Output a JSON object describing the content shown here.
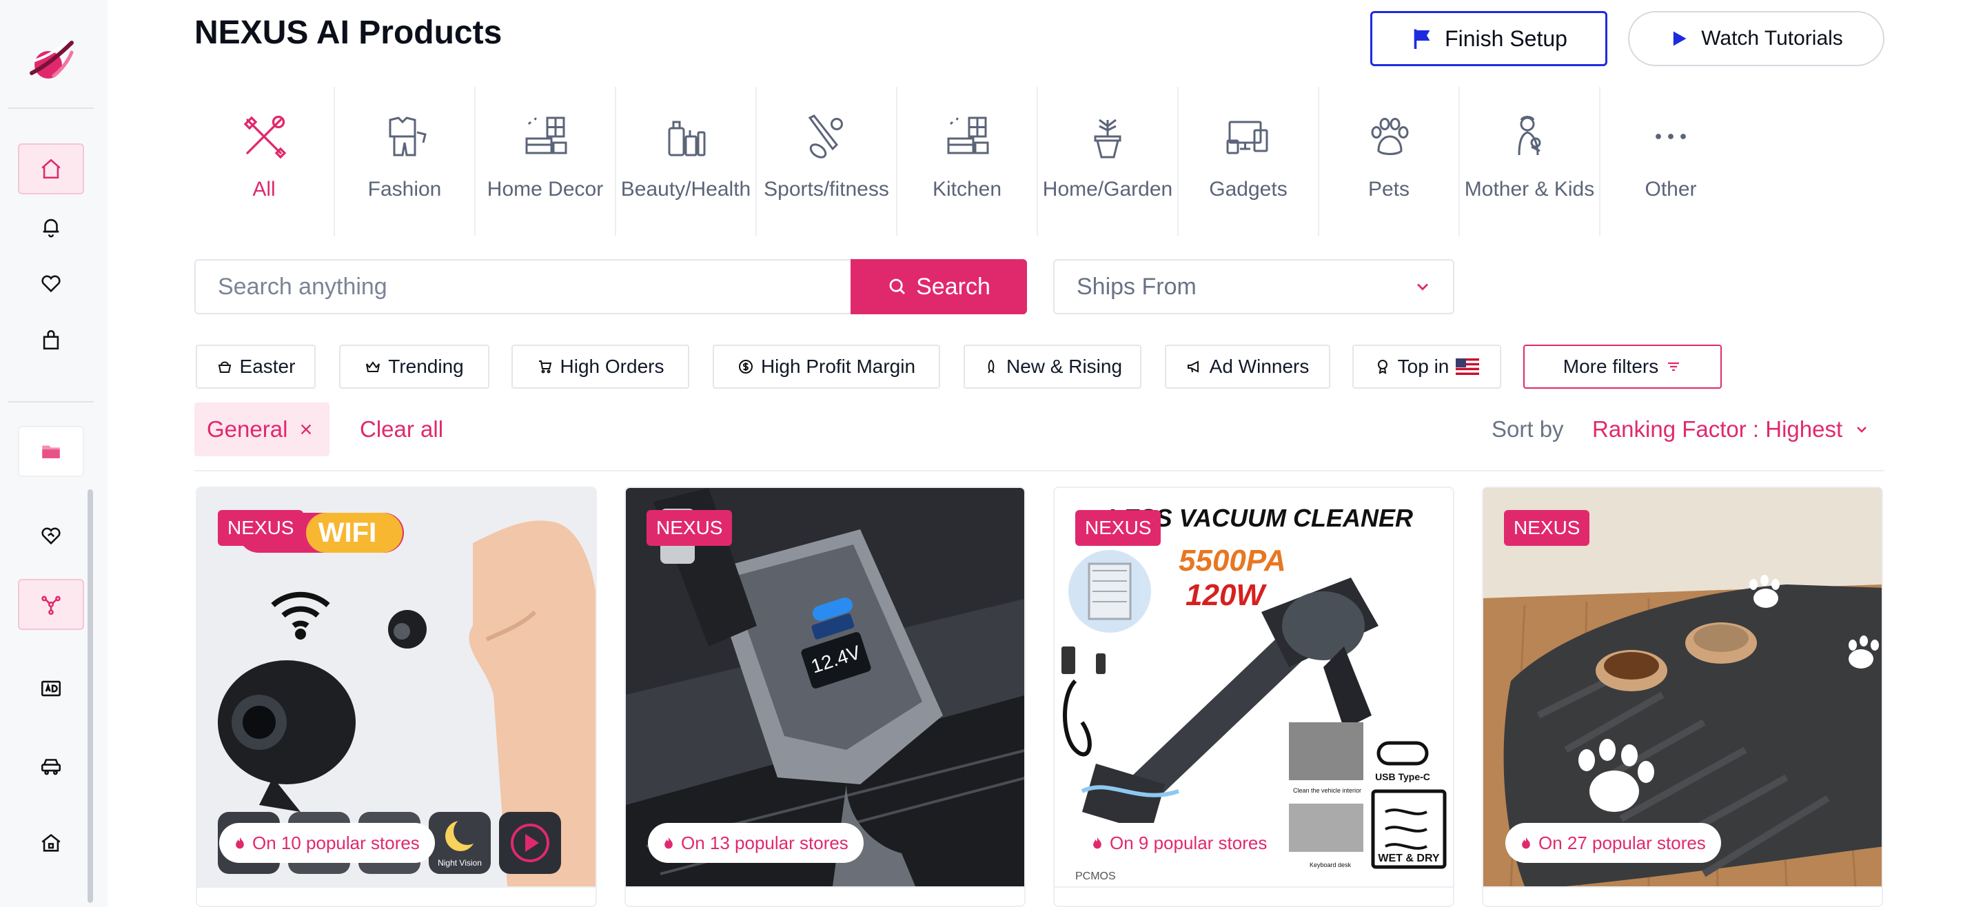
{
  "header": {
    "title": "NEXUS AI Products",
    "finish_setup": "Finish Setup",
    "watch_tutorials": "Watch Tutorials"
  },
  "categories": [
    {
      "label": "All",
      "icon": "tools-icon",
      "active": true
    },
    {
      "label": "Fashion",
      "icon": "clothing-icon"
    },
    {
      "label": "Home Decor",
      "icon": "furniture-icon"
    },
    {
      "label": "Beauty/Health",
      "icon": "cosmetics-icon"
    },
    {
      "label": "Sports/fitness",
      "icon": "sports-icon"
    },
    {
      "label": "Kitchen",
      "icon": "kitchen-icon"
    },
    {
      "label": "Home/Garden",
      "icon": "plant-icon"
    },
    {
      "label": "Gadgets",
      "icon": "devices-icon"
    },
    {
      "label": "Pets",
      "icon": "paw-icon"
    },
    {
      "label": "Mother & Kids",
      "icon": "mother-child-icon"
    },
    {
      "label": "Other",
      "icon": "more-dots-icon"
    }
  ],
  "search": {
    "placeholder": "Search anything",
    "button": "Search",
    "ships_from": "Ships From"
  },
  "filters": {
    "easter": "Easter",
    "trending": "Trending",
    "high_orders": "High Orders",
    "high_profit": "High Profit Margin",
    "new_rising": "New & Rising",
    "ad_winners": "Ad Winners",
    "top_in": "Top in",
    "more_filters": "More filters"
  },
  "applied": {
    "tag": "General",
    "clear_all": "Clear all",
    "sort_by": "Sort by",
    "sort_value": "Ranking Factor : Highest"
  },
  "products": [
    {
      "badge": "NEXUS",
      "stores": "On 10 popular stores",
      "image_text": "WIFI",
      "secondary_text": "Night Vision"
    },
    {
      "badge": "NEXUS",
      "stores": "On 13 popular stores",
      "image_text": "12.4V"
    },
    {
      "badge": "NEXUS",
      "stores": "On 9 popular stores",
      "image_text": "LESS VACUUM CLEANER",
      "power_text": "5500PA",
      "watt_text": "120W",
      "usb_text": "USB Type-C",
      "wet_dry_text": "WET & DRY",
      "brand_text": "PCMOS",
      "caption1": "Clean the vehicle interior",
      "caption2": "Keyboard desk"
    },
    {
      "badge": "NEXUS",
      "stores": "On 27 popular stores"
    }
  ],
  "colors": {
    "accent": "#e0296d",
    "finish_border": "#1d2be0",
    "muted": "#6a7386"
  }
}
